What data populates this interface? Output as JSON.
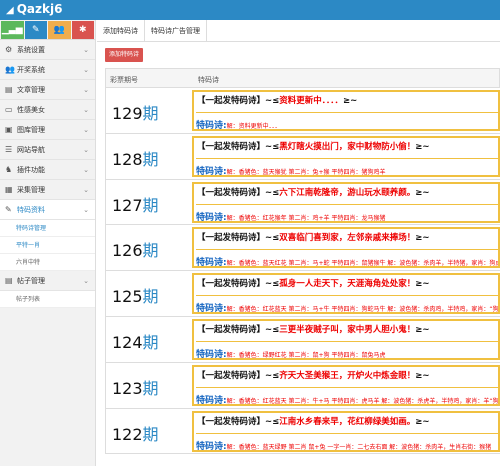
{
  "app": {
    "title": "Qazkj6"
  },
  "quick_buttons": [
    {
      "name": "stats",
      "glyph": "▁▃▅",
      "color": "#5cb85c"
    },
    {
      "name": "edit",
      "glyph": "✎",
      "color": "#2c89c5"
    },
    {
      "name": "users",
      "glyph": "👥",
      "color": "#f0ad4e"
    },
    {
      "name": "settings",
      "glyph": "✱",
      "color": "#d9534f"
    }
  ],
  "sidebar": {
    "items": [
      {
        "label": "系统设置",
        "icon": "⚙"
      },
      {
        "label": "开奖系统",
        "icon": "👥"
      },
      {
        "label": "文章管理",
        "icon": "▤"
      },
      {
        "label": "性感美女",
        "icon": "▭"
      },
      {
        "label": "图库管理",
        "icon": "▣"
      },
      {
        "label": "网站导航",
        "icon": "☰"
      },
      {
        "label": "插件功能",
        "icon": "♞"
      },
      {
        "label": "采集管理",
        "icon": "▦"
      },
      {
        "label": "特码资料",
        "icon": "✎"
      }
    ],
    "subitems": [
      {
        "label": "特码诗管理"
      },
      {
        "label": "平特一肖"
      },
      {
        "label": "六肖中特"
      }
    ],
    "items2": [
      {
        "label": "帖子管理",
        "icon": "▤"
      }
    ],
    "subitems2": [
      {
        "label": "帖子列表"
      }
    ]
  },
  "tabs": [
    {
      "label": "添加特码诗"
    },
    {
      "label": "特码诗广告管理"
    }
  ],
  "add_button": "添加特码诗",
  "table": {
    "headers": [
      "彩票期号",
      "特码诗"
    ],
    "qi_label": "期",
    "poem_prefix": "【一起发特码诗】~≤",
    "poem_suffix": "≥~",
    "rows": [
      {
        "period": "129",
        "poem": "资料更新中．．．．",
        "explain_label": "特码诗:",
        "explain": "解：资料更新中．．．"
      },
      {
        "period": "128",
        "poem": "黑灯瞎火摸出门，家中财物防小偷！",
        "explain_label": "特码诗:",
        "explain": "解：香猪色：蓝天猴犹 第二肖：兔+猴 平特四肖：猪狗鸡羊"
      },
      {
        "period": "127",
        "poem": "六下江南乾隆帝，游山玩水颐养颜。",
        "explain_label": "特码诗:",
        "explain": "解：香猪色：红花猴年 第二肖：鸡+羊 平特四肖：龙马猴猪"
      },
      {
        "period": "126",
        "poem": "双喜临门喜到家，左邻亲戚来捧场！",
        "explain_label": "特码诗:",
        "explain": "解：香猪色：蓝天红花 第二肖：马+蛇 平特四肖：鼠猪猴牛 解：波色猪：杀肉羊，半特猪，家肖：狗虎猪"
      },
      {
        "period": "125",
        "poem": "孤身一人走天下，天涯海角处处家！",
        "explain_label": "特码诗:",
        "explain": "解：香猪色：红花蓝天 第二肖：马+牛 平特四肖：狗蛇马牛 解：波色猪：杀肉鸡，半特鸡，家肖：“狗”"
      },
      {
        "period": "124",
        "poem": "三更半夜贼子叫，家中男人胆小鬼！",
        "explain_label": "特码诗:",
        "explain": "解：香猪色：绿野红花 第二肖：鼠+狗 平特四肖：鼠兔马虎"
      },
      {
        "period": "123",
        "poem": "齐天大圣美猴王，开炉火中炼金眼！",
        "explain_label": "特码诗:",
        "explain": "解：香猪色：红花蓝天 第二肖：牛+马 平特四肖：虎马羊 解：波色猪：杀虎羊，半特鸡，家肖：羊“狗”"
      },
      {
        "period": "122",
        "poem": "江南水乡春来早，花红柳绿美如画。",
        "explain_label": "特码诗:",
        "explain": "解：香猪色：蓝天绿野 第二肖 鼠+兔 一字一肖：二七去右面 解：波色猪：杀肉羊，生肖右街：猴猪"
      }
    ]
  }
}
